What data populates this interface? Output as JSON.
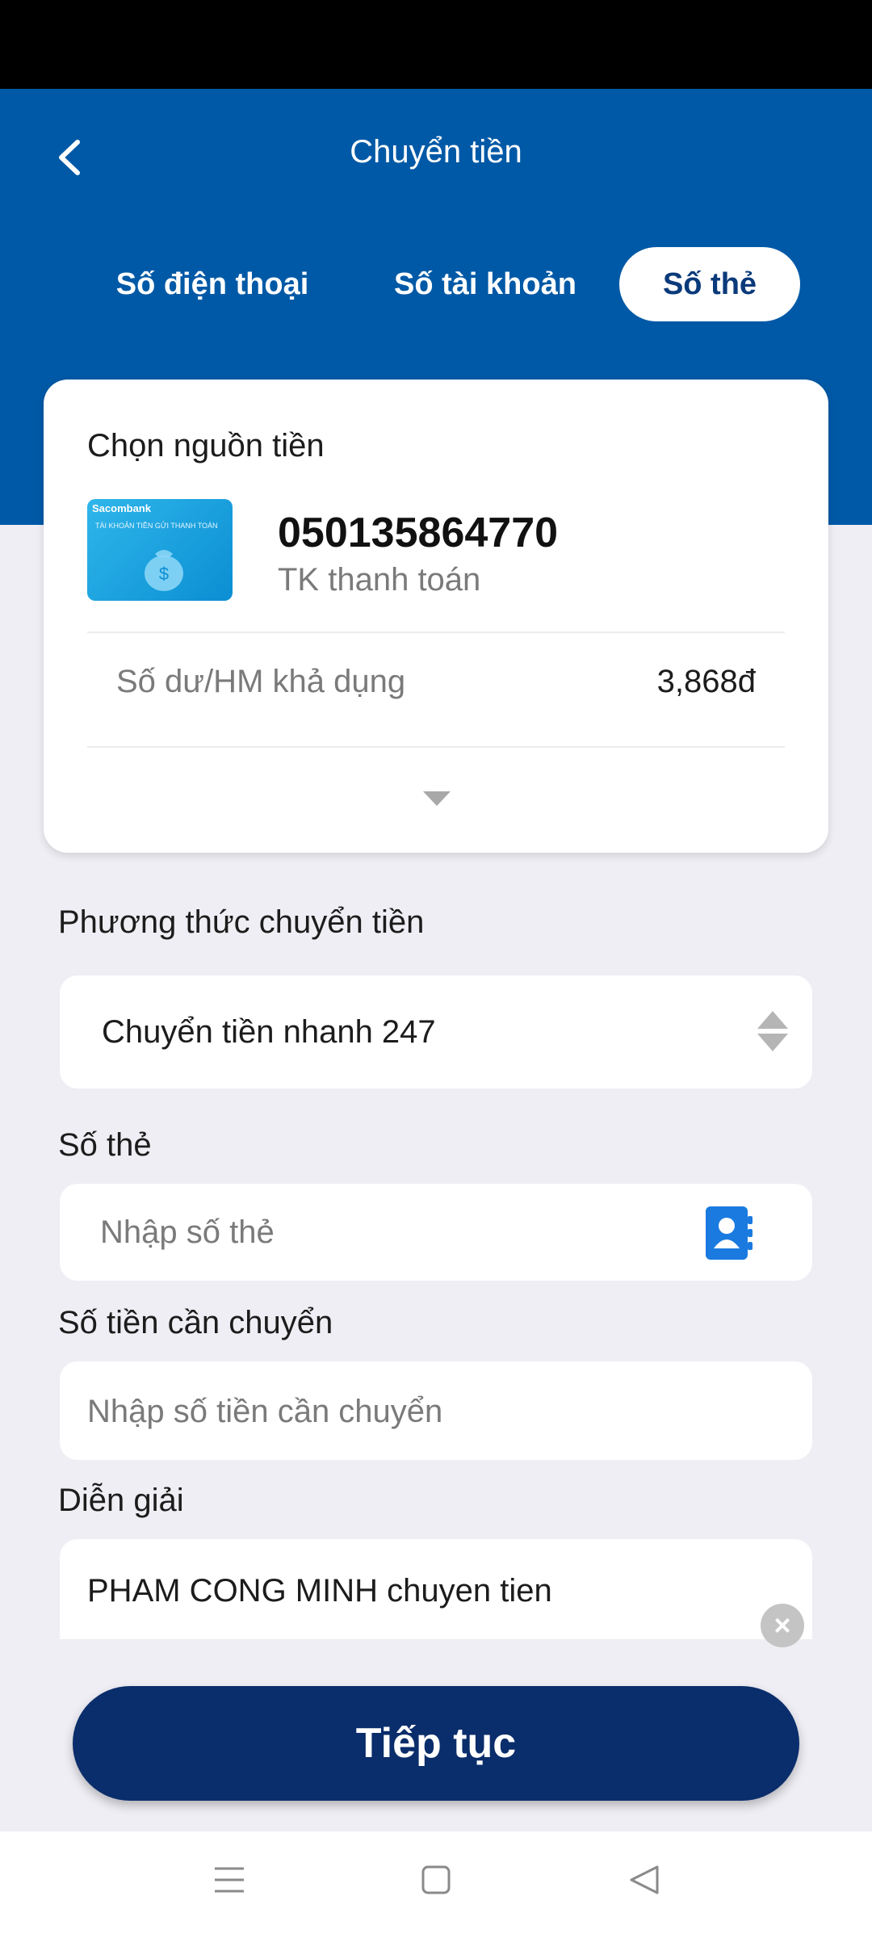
{
  "header": {
    "title": "Chuyển tiền",
    "tabs": [
      {
        "label": "Số điện thoại",
        "active": false
      },
      {
        "label": "Số tài khoản",
        "active": false
      },
      {
        "label": "Số thẻ",
        "active": true
      }
    ]
  },
  "source": {
    "label": "Chọn nguồn tiền",
    "card_brand": "Sacombank",
    "card_caption": "TÀI KHOẢN TIỀN GỬI THANH TOÁN",
    "account_number": "050135864770",
    "account_type": "TK thanh toán",
    "balance_label": "Số dư/HM khả dụng",
    "balance_value": "3,868đ"
  },
  "method": {
    "label": "Phương thức chuyển tiền",
    "value": "Chuyển tiền nhanh 247"
  },
  "card_number": {
    "label": "Số thẻ",
    "placeholder": "Nhập số thẻ"
  },
  "amount": {
    "label": "Số tiền cần chuyển",
    "placeholder": "Nhập số tiền cần chuyển"
  },
  "description": {
    "label": "Diễn giải",
    "value": "PHAM CONG MINH chuyen tien"
  },
  "continue_label": "Tiếp tục",
  "colors": {
    "header_blue": "#0059a6",
    "button_navy": "#0a2d6b",
    "contact_icon_blue": "#1a7ae0"
  }
}
